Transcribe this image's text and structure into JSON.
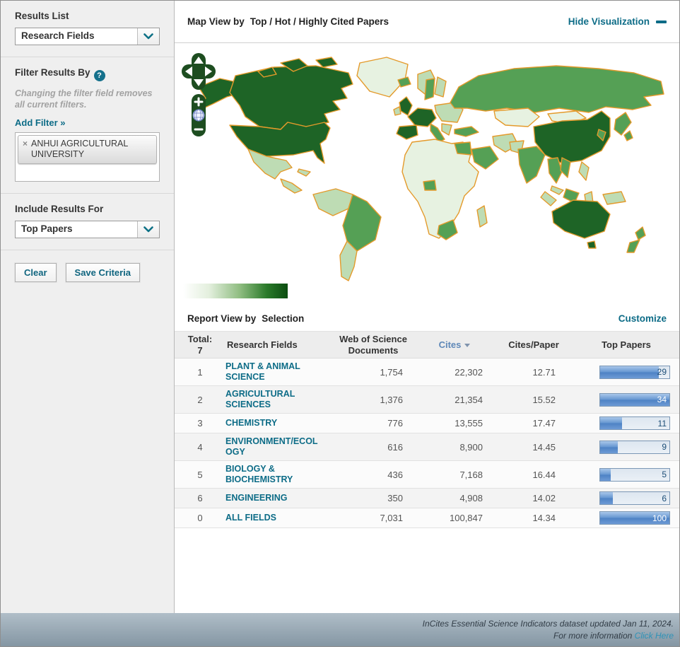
{
  "sidebar": {
    "results_list_label": "Results List",
    "results_list_value": "Research Fields",
    "filter_title": "Filter Results By",
    "filter_note": "Changing the filter field removes all current filters.",
    "add_filter_label": "Add Filter »",
    "filter_chip": "ANHUI AGRICULTURAL UNIVERSITY",
    "include_label": "Include Results For",
    "include_value": "Top Papers",
    "clear_label": "Clear",
    "save_label": "Save Criteria"
  },
  "icons": {
    "remove_filter": "×",
    "help": "?"
  },
  "map_panel": {
    "title_prefix": "Map View by",
    "title_value": "Top / Hot / Highly Cited Papers",
    "hide_link": "Hide Visualization"
  },
  "report_panel": {
    "title_prefix": "Report View by",
    "title_value": "Selection",
    "customize_link": "Customize",
    "table": {
      "total_label": "Total:",
      "total_value": "7",
      "columns": {
        "research_fields": "Research Fields",
        "docs": "Web of Science Documents",
        "cites": "Cites",
        "cites_per_paper": "Cites/Paper",
        "top_papers": "Top Papers"
      },
      "sorted_column": "Cites",
      "rows": [
        {
          "rank": "1",
          "field": "PLANT & ANIMAL SCIENCE",
          "docs": "1,754",
          "cites": "22,302",
          "cites_per_paper": "12.71",
          "top_papers": "29",
          "bar_pct": 85
        },
        {
          "rank": "2",
          "field": "AGRICULTURAL SCIENCES",
          "docs": "1,376",
          "cites": "21,354",
          "cites_per_paper": "15.52",
          "top_papers": "34",
          "bar_pct": 100
        },
        {
          "rank": "3",
          "field": "CHEMISTRY",
          "docs": "776",
          "cites": "13,555",
          "cites_per_paper": "17.47",
          "top_papers": "11",
          "bar_pct": 32
        },
        {
          "rank": "4",
          "field": "ENVIRONMENT/ECOLOGY",
          "docs": "616",
          "cites": "8,900",
          "cites_per_paper": "14.45",
          "top_papers": "9",
          "bar_pct": 26
        },
        {
          "rank": "5",
          "field": "BIOLOGY & BIOCHEMISTRY",
          "docs": "436",
          "cites": "7,168",
          "cites_per_paper": "16.44",
          "top_papers": "5",
          "bar_pct": 15
        },
        {
          "rank": "6",
          "field": "ENGINEERING",
          "docs": "350",
          "cites": "4,908",
          "cites_per_paper": "14.02",
          "top_papers": "6",
          "bar_pct": 18
        },
        {
          "rank": "0",
          "field": "ALL FIELDS",
          "docs": "7,031",
          "cites": "100,847",
          "cites_per_paper": "14.34",
          "top_papers": "100",
          "bar_pct": 100
        }
      ]
    }
  },
  "map_colors": {
    "border": "#e49a2b",
    "scale_dark": "#1e6426",
    "scale_medium": "#55a055",
    "scale_light": "#bedcb4",
    "scale_very_light": "#e7f2e1"
  },
  "footer": {
    "line1": "InCites Essential Science Indicators dataset updated Jan 11, 2024.",
    "line2_prefix": "For more information",
    "line2_link": "Click Here"
  }
}
